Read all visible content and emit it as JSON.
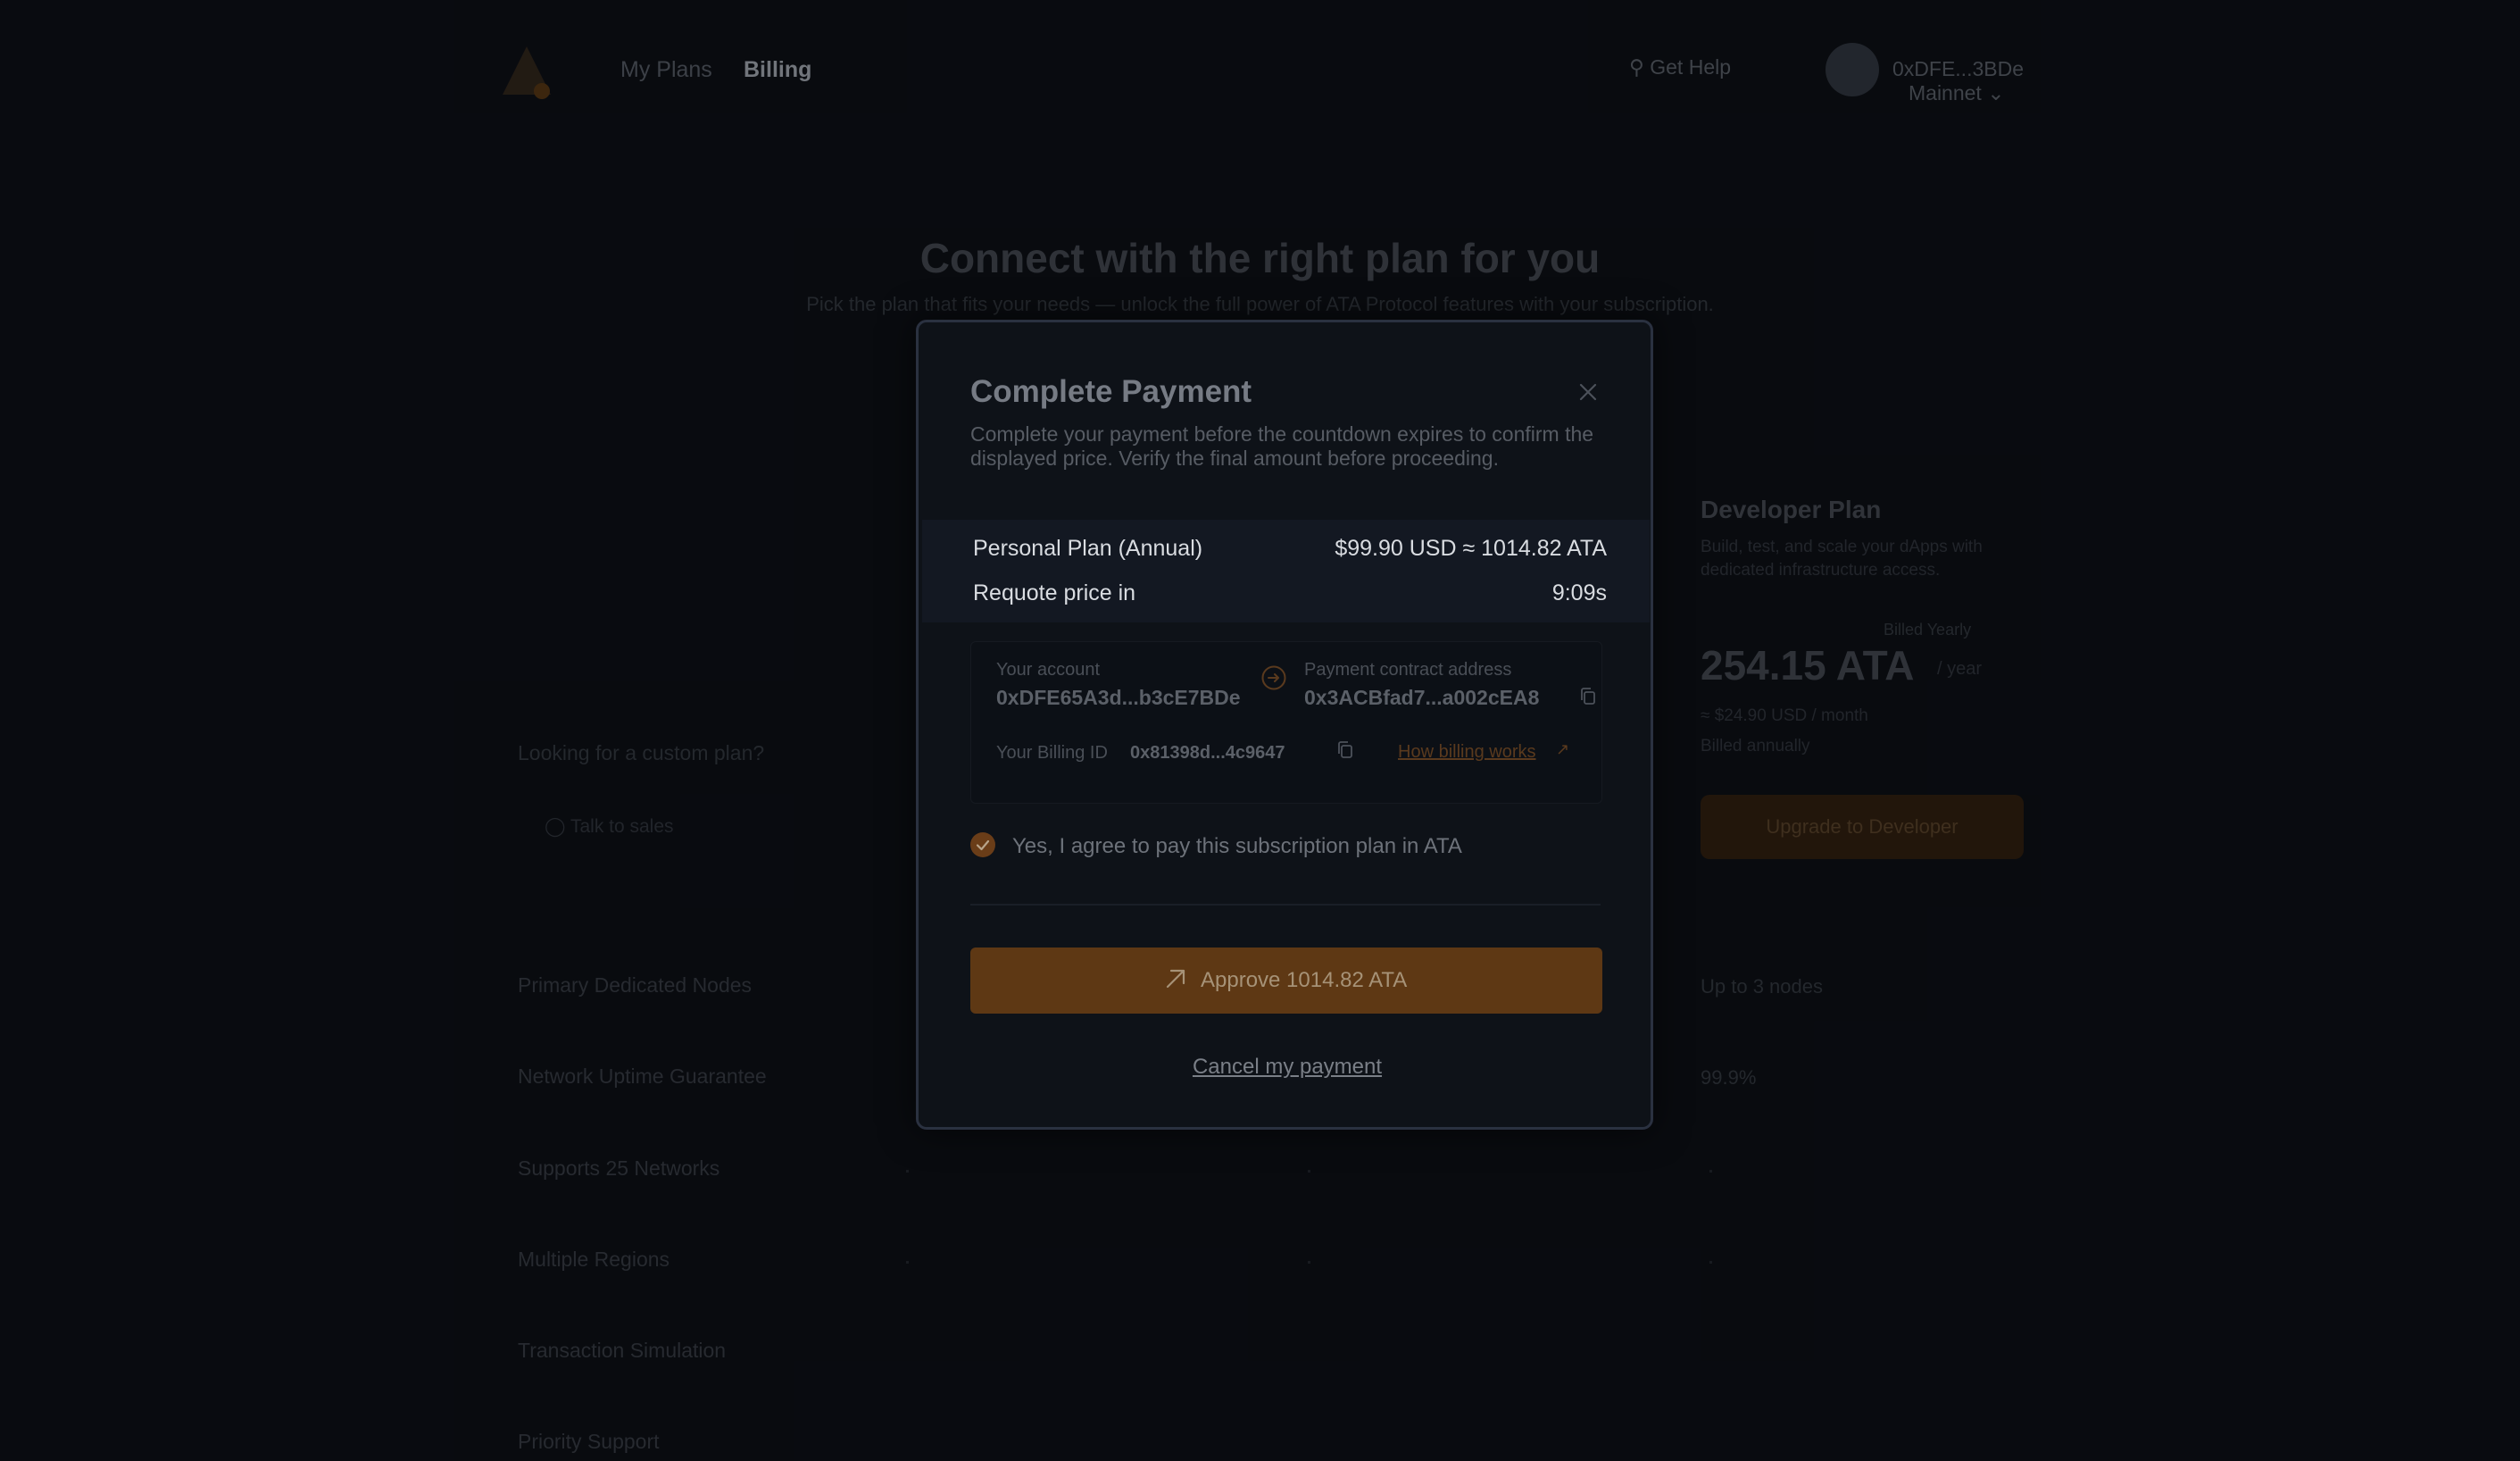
{
  "nav": {
    "links": [
      "My Plans",
      "Billing"
    ],
    "search": "Get Help",
    "user": "0xDFE...3BDe",
    "network": "Mainnet"
  },
  "hero": {
    "title": "Connect with the right plan for you",
    "subtitle": "Pick the plan that fits your needs — unlock the full power of ATA Protocol features with your subscription."
  },
  "plan_card": {
    "title": "Developer Plan",
    "desc": "Build, test, and scale your dApps with dedicated infrastructure access.",
    "badge": "Billed Yearly",
    "price": "254.15 ATA",
    "period": "/ year",
    "note1": "≈ $24.90 USD / month",
    "note2": "Billed annually",
    "button": "Upgrade to Developer"
  },
  "left": {
    "label": "Looking for a custom plan?",
    "check": "Talk to sales"
  },
  "features": [
    {
      "label": "Primary Dedicated Nodes",
      "value": "Up to 3 nodes"
    },
    {
      "label": "Network Uptime Guarantee",
      "value": "99.9%"
    },
    {
      "label": "Supports 25 Networks",
      "value": ""
    },
    {
      "label": "Multiple Regions",
      "value": ""
    },
    {
      "label": "Transaction Simulation",
      "value": ""
    },
    {
      "label": "Priority Support",
      "value": ""
    }
  ],
  "modal": {
    "title": "Complete Payment",
    "description": "Complete your payment before the countdown expires to confirm the displayed price. Verify the final amount before proceeding.",
    "plan_name": "Personal Plan (Annual)",
    "plan_price": "$99.90 USD ≈ 1014.82 ATA",
    "requote_label": "Requote price in",
    "requote_time": "9:09s",
    "account_label": "Your account",
    "account_value": "0xDFE65A3d...b3cE7BDe",
    "contract_label": "Payment contract address",
    "contract_value": "0x3ACBfad7...a002cEA8",
    "billing_label": "Your Billing ID",
    "billing_value": "0x81398d...4c9647",
    "how_link": "How billing works",
    "agree_label": "Yes, I agree to pay this subscription plan in ATA",
    "approve_label": "Approve 1014.82 ATA",
    "cancel_label": "Cancel my payment"
  },
  "colors": {
    "accent": "#5e3814",
    "modal_bg": "#0e1218",
    "page_bg": "#0b0e13"
  }
}
